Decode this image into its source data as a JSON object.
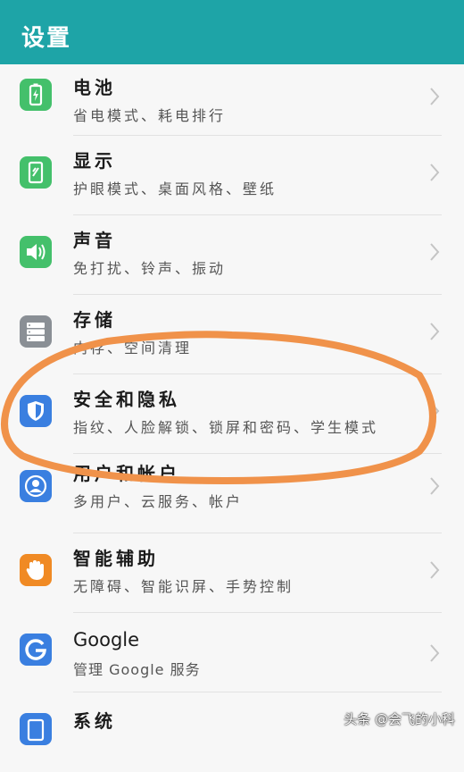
{
  "header": {
    "title": "设置"
  },
  "items": [
    {
      "title": "电池",
      "subtitle": "省电模式、耗电排行",
      "icon": "battery-icon",
      "color": "#44c06b"
    },
    {
      "title": "显示",
      "subtitle": "护眼模式、桌面风格、壁纸",
      "icon": "display-icon",
      "color": "#44c06b"
    },
    {
      "title": "声音",
      "subtitle": "免打扰、铃声、振动",
      "icon": "speaker-icon",
      "color": "#44c06b"
    },
    {
      "title": "存储",
      "subtitle": "内存、空间清理",
      "icon": "storage-icon",
      "color": "#8a8f95"
    },
    {
      "title": "安全和隐私",
      "subtitle": "指纹、人脸解锁、锁屏和密码、学生模式",
      "icon": "shield-icon",
      "color": "#3a7fe0"
    },
    {
      "title": "用户和帐户",
      "subtitle": "多用户、云服务、帐户",
      "icon": "user-icon",
      "color": "#3a7fe0"
    },
    {
      "title": "智能辅助",
      "subtitle": "无障碍、智能识屏、手势控制",
      "icon": "hand-icon",
      "color": "#f08a24"
    },
    {
      "title": "Google",
      "subtitle": "管理 Google 服务",
      "icon": "google-icon",
      "color": "#3a7fe0"
    },
    {
      "title": "系统",
      "subtitle": "",
      "icon": "system-icon",
      "color": "#3a7fe0"
    }
  ],
  "watermark": "头条 @会飞的小科",
  "annotation_color": "#f0924a"
}
